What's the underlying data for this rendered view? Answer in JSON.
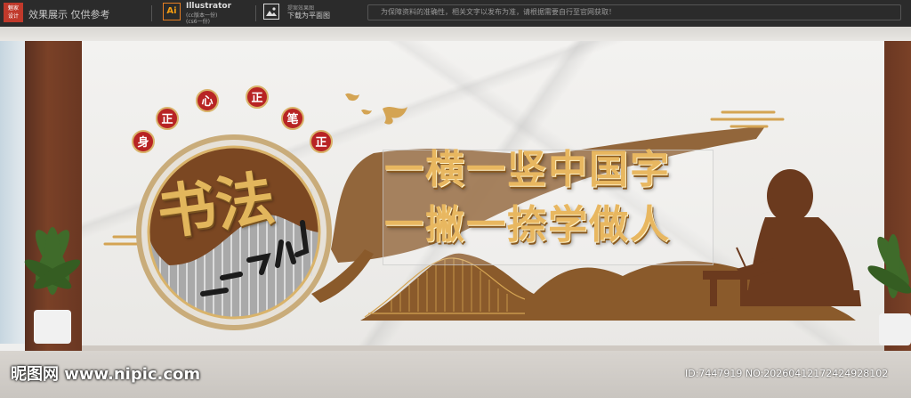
{
  "toolbar": {
    "brand_line1": "魅家",
    "brand_line2": "设计",
    "preview_text": "效果展示 仅供参考",
    "ai_icon": "Ai",
    "ai_label": "Illustrator",
    "ai_sub1": "(cc版本一份)",
    "ai_sub2": "(cs6一份)",
    "image_sub1": "提案效果图",
    "image_sub2": "下载为平面图",
    "notice": "为保障资料的准确性，相关文字以发布为准，请根据需要自行至官网获取！"
  },
  "artwork": {
    "ring_chars": [
      "身",
      "正",
      "心",
      "正",
      "笔",
      "正"
    ],
    "calligraphy": "书法",
    "headline_line1": "一横一竖中国字",
    "headline_line2": "一撇一捺学做人"
  },
  "footer": {
    "watermark": "昵图网 www.nipic.com",
    "id_text": "ID:7447919 NO:20260412172424928102"
  },
  "colors": {
    "gold": "#e2b65c",
    "brown": "#8a5a2b",
    "red": "#b82424",
    "wood": "#6a3722"
  }
}
